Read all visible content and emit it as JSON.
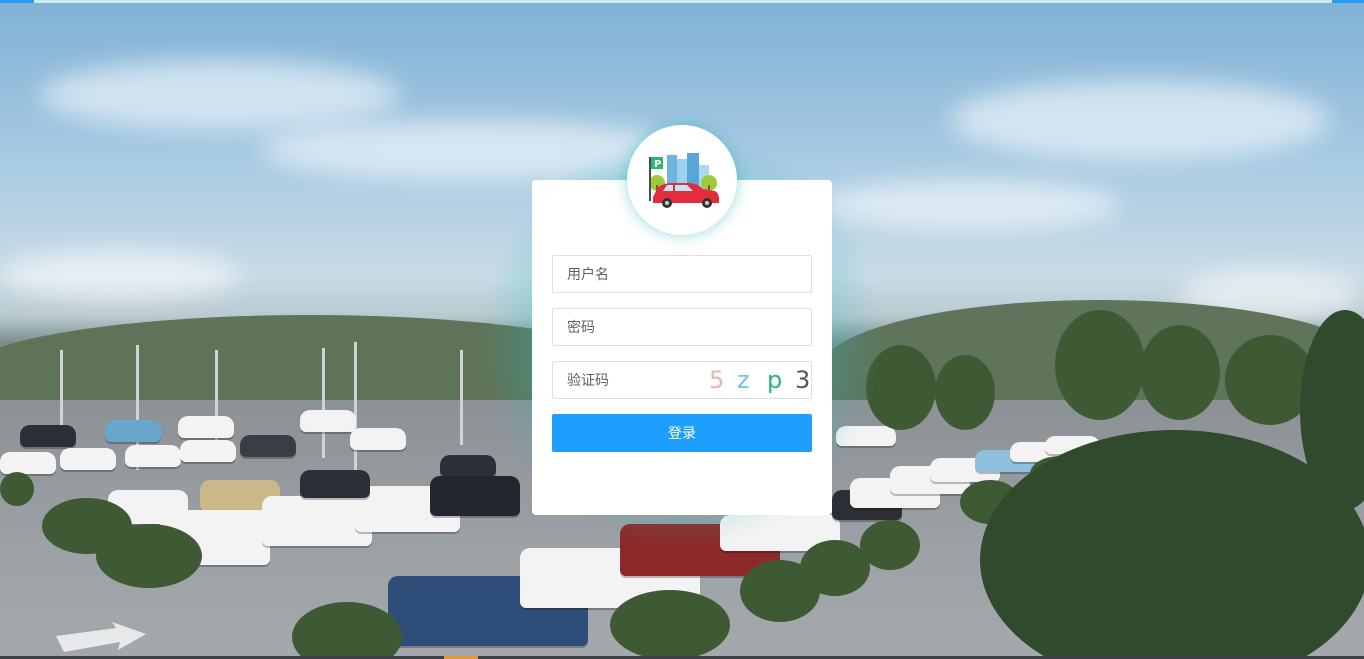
{
  "login": {
    "username_placeholder": "用户名",
    "password_placeholder": "密码",
    "captcha_placeholder": "验证码",
    "captcha_chars": [
      "5",
      "z",
      "p",
      "3"
    ],
    "captcha_colors": [
      "#e8b4b0",
      "#6fc2e8",
      "#2bb673",
      "#5a5a5a"
    ],
    "submit_label": "登录"
  },
  "logo": {
    "icon": "parking-lot-car-icon",
    "sign_letter": "P"
  },
  "colors": {
    "primary_button": "#1e9fff",
    "glow": "#28bebe"
  }
}
